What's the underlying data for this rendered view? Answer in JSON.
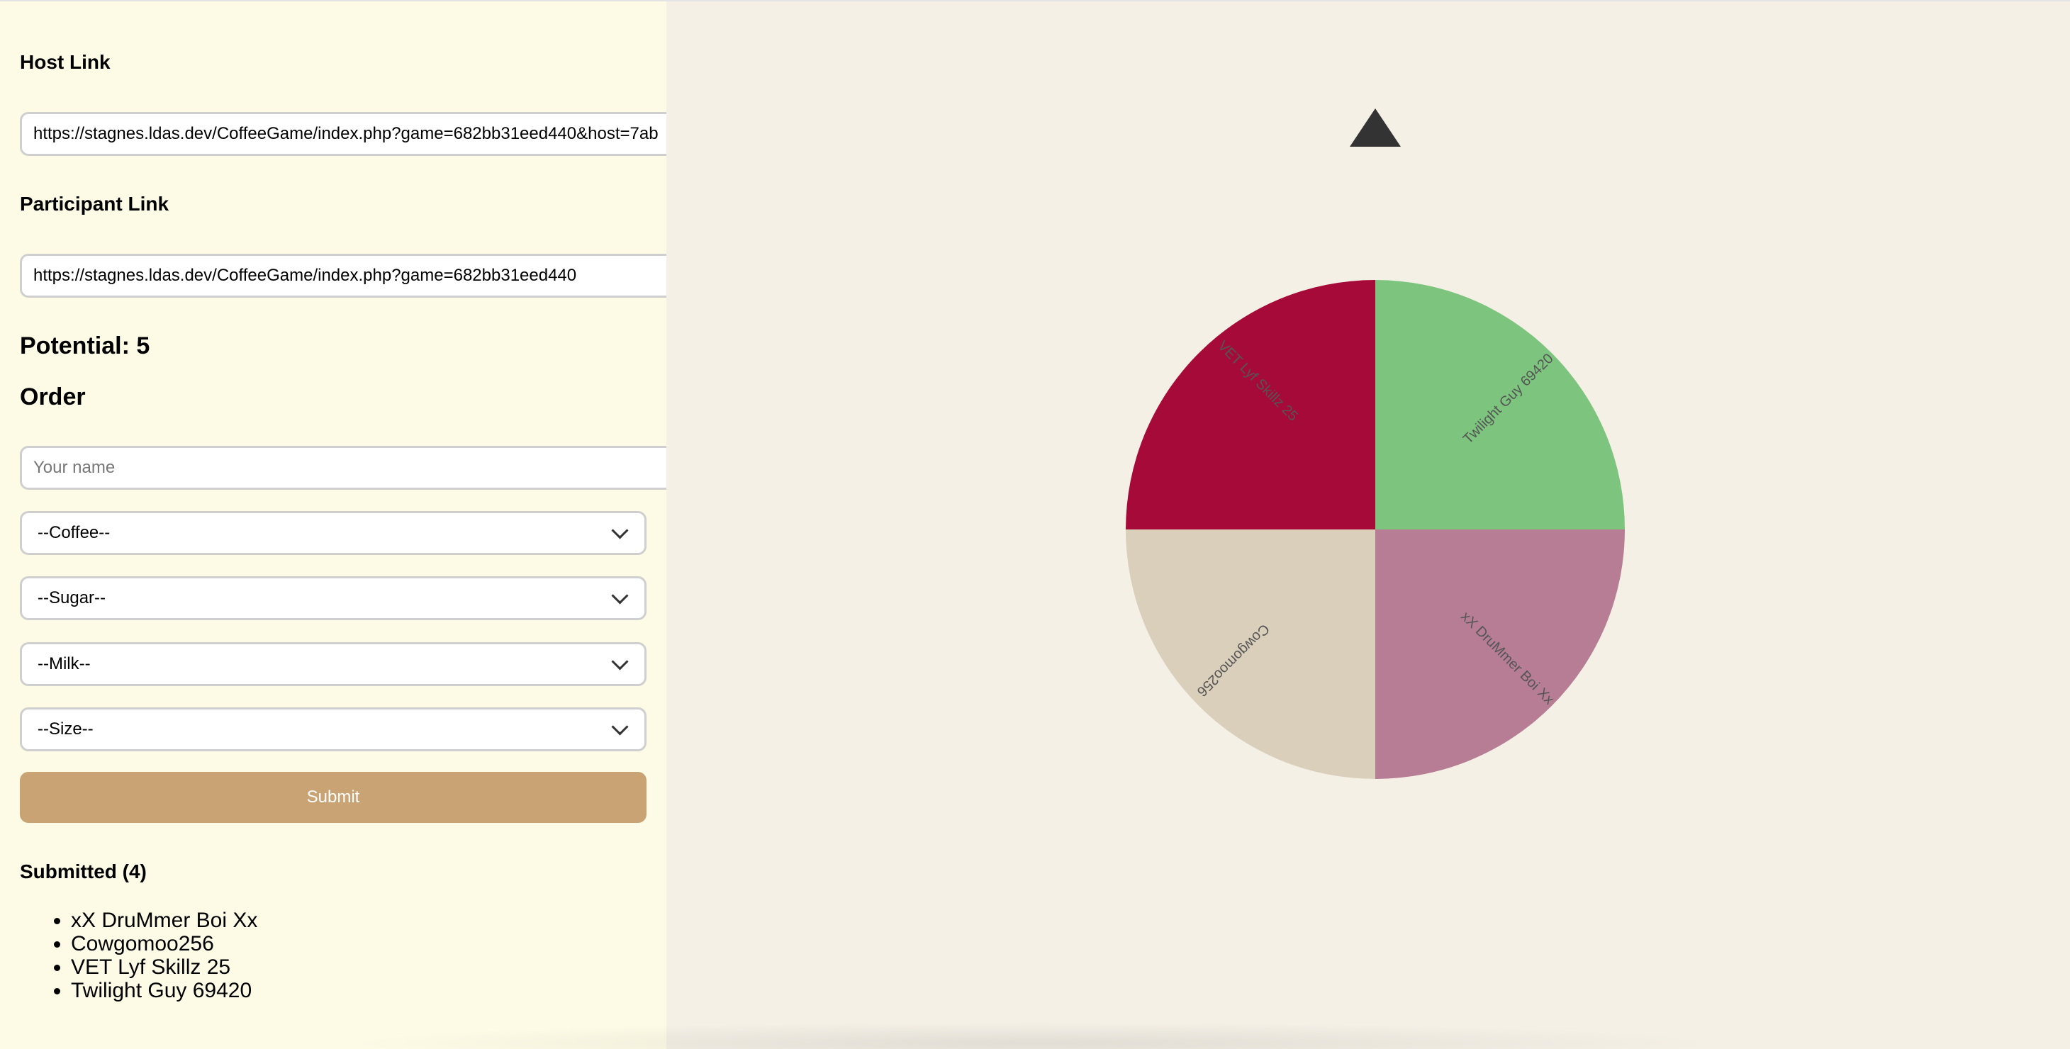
{
  "host": {
    "heading": "Host Link",
    "url": "https://stagnes.ldas.dev/CoffeeGame/index.php?game=682bb31eed440&host=7ab"
  },
  "participant": {
    "heading": "Participant Link",
    "url": "https://stagnes.ldas.dev/CoffeeGame/index.php?game=682bb31eed440"
  },
  "potential": "Potential: 5",
  "order": {
    "heading": "Order",
    "name_placeholder": "Your name",
    "coffee": "--Coffee--",
    "sugar": "--Sugar--",
    "milk": "--Milk--",
    "size": "--Size--",
    "submit_label": "Submit"
  },
  "submitted": {
    "heading": "Submitted (4)",
    "items": [
      "xX DruMmer Boi Xx",
      "Cowgomoo256",
      "VET Lyf Skillz 25",
      "Twilight Guy 69420"
    ]
  },
  "wheel": {
    "segments": [
      {
        "label": "VET Lyf Skillz 25",
        "color": "#a60a38"
      },
      {
        "label": "Twilight Guy 69420",
        "color": "#7dc57e"
      },
      {
        "label": "xX DruMmer Boi Xx",
        "color": "#b67d95"
      },
      {
        "label": "Cowgomoo256",
        "color": "#dacfbb"
      }
    ]
  },
  "colors": {
    "sidebar_bg": "#fdfbe6",
    "main_bg": "#f5f0e6",
    "submit_button": "#c9a373",
    "pointer": "#333333"
  }
}
